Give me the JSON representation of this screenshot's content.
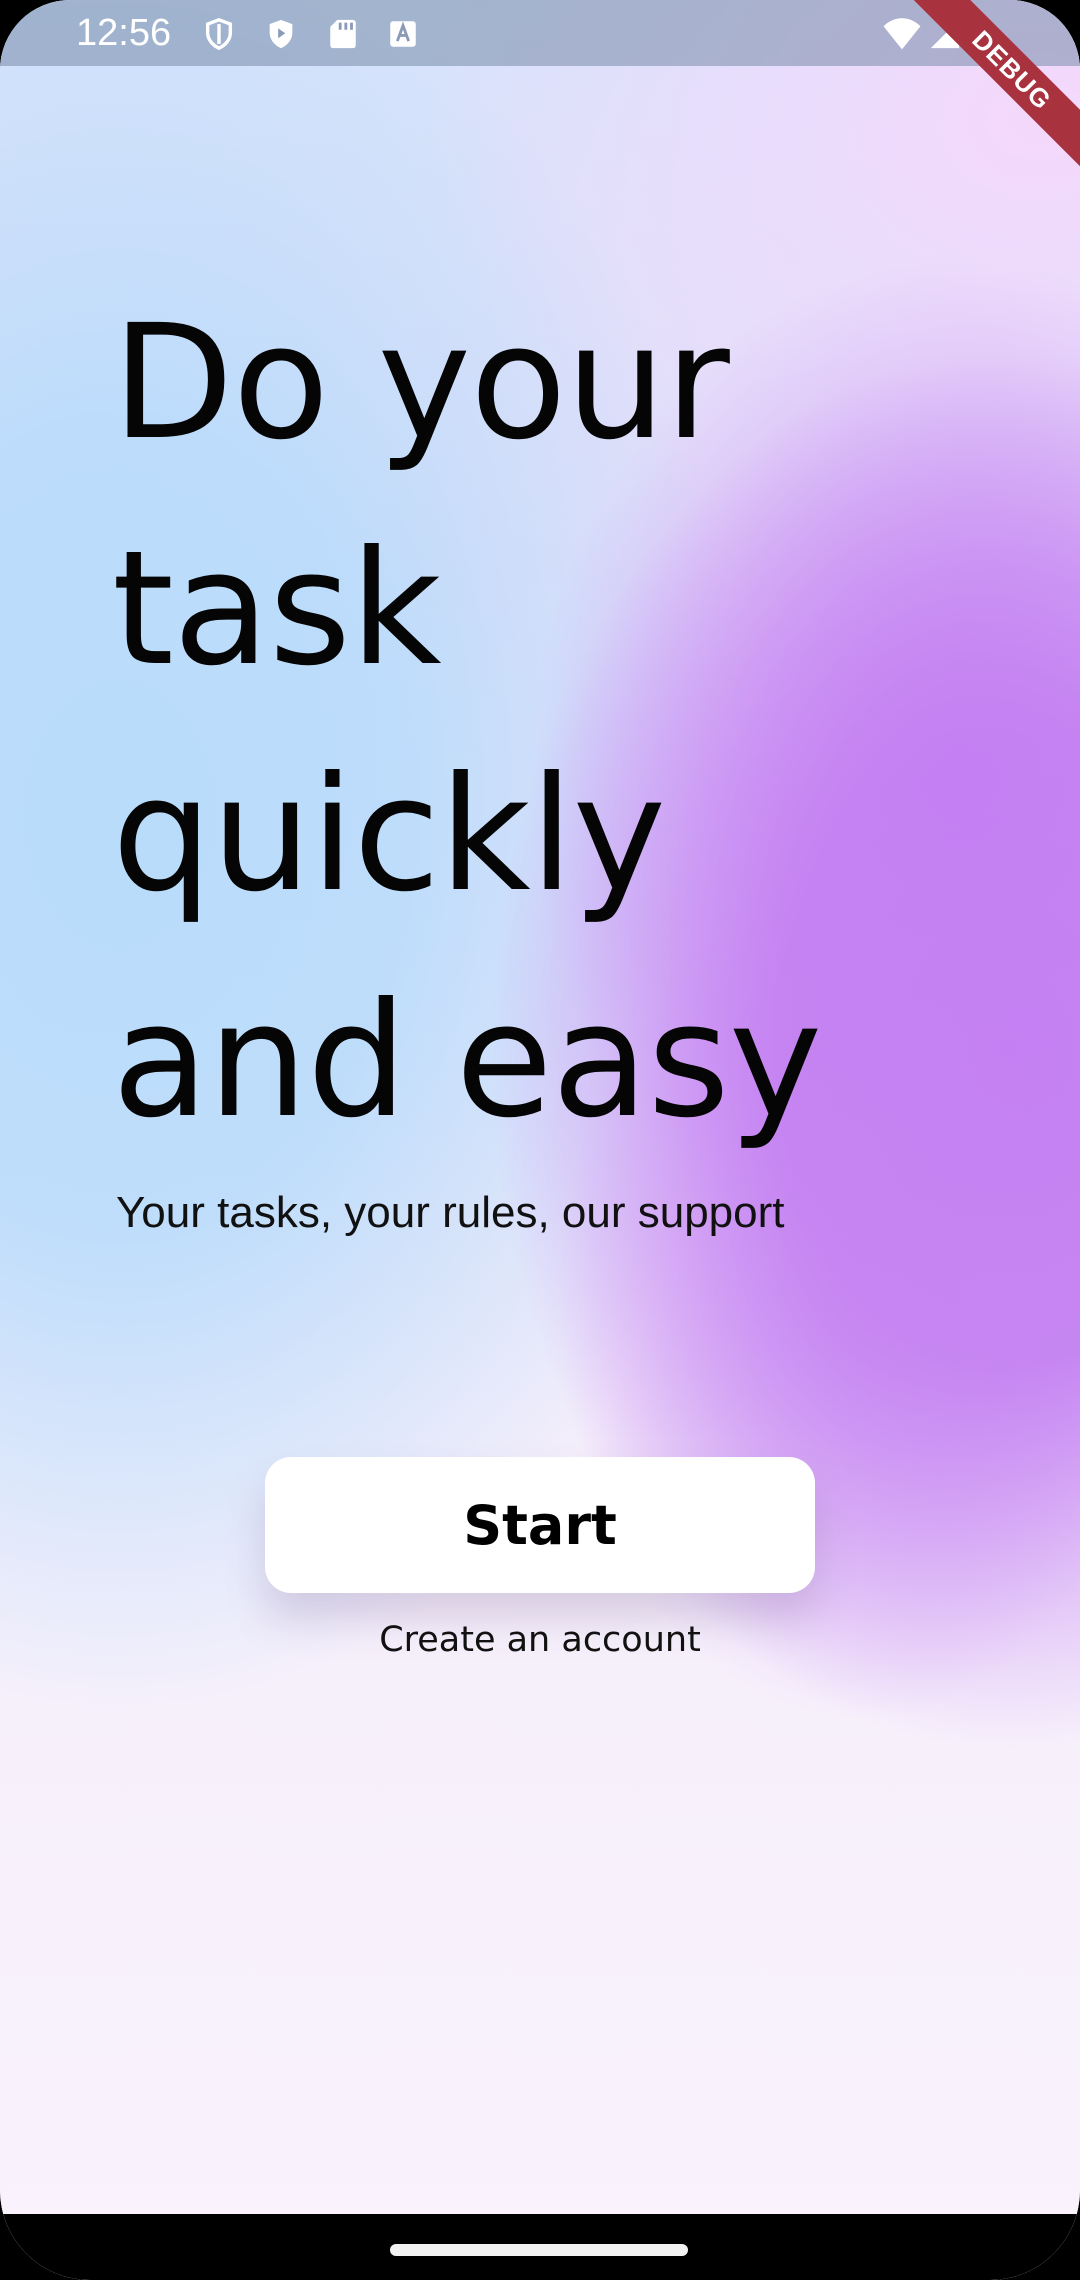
{
  "status_bar": {
    "time": "12:56",
    "left_icons": [
      "shield-icon",
      "play-protect-icon",
      "sd-card-icon",
      "a-icon"
    ],
    "right_icons": [
      "wifi-icon",
      "signal-icon"
    ]
  },
  "debug_banner": "DEBUG",
  "headline_lines": [
    "Do your",
    "task",
    "quickly",
    "and easy"
  ],
  "subtitle": "Your tasks, your rules, our support",
  "start_button": "Start",
  "create_account": "Create an account",
  "colors": {
    "purple": "#c481f2",
    "blue": "#b9dcfb",
    "pink": "#f5d8fc",
    "debug_red": "#a8323e"
  }
}
